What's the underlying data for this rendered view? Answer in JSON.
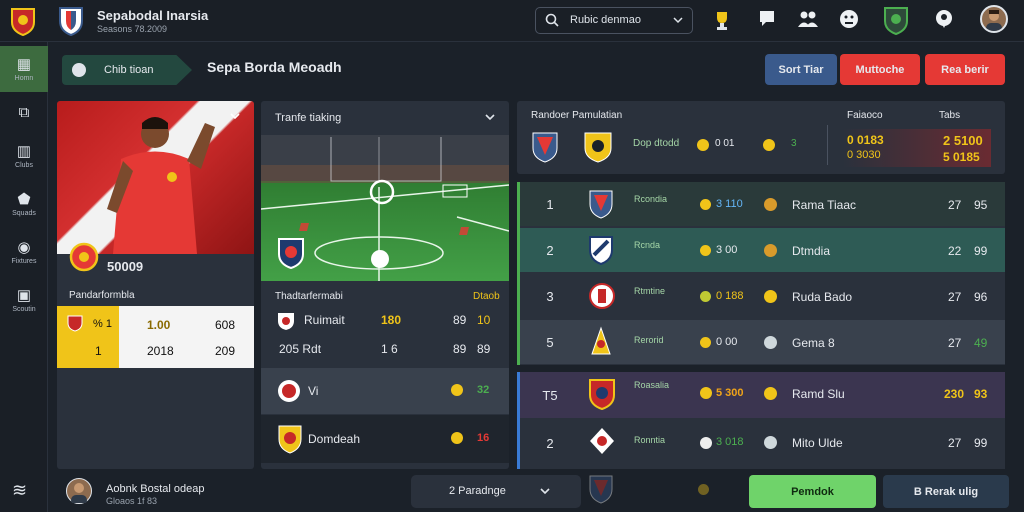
{
  "app": {
    "title": "Sepabodal Inarsia",
    "subtitle": "Seasons 78.2009"
  },
  "search": {
    "value": "Rubic denmao"
  },
  "nav": {
    "active_label": "Chib tioan"
  },
  "page_title": "Sepa Borda Meoadh",
  "sidebar": {
    "items": [
      {
        "label": "Homn",
        "icon": "dashboard-icon"
      },
      {
        "label": "",
        "icon": "inbox-icon"
      },
      {
        "label": "Clubs",
        "icon": "building-icon"
      },
      {
        "label": "Squads",
        "icon": "shield-icon"
      },
      {
        "label": "Fixtures",
        "icon": "ball-icon"
      },
      {
        "label": "Scoutin",
        "icon": "bag-icon"
      }
    ]
  },
  "header_buttons": [
    {
      "label": "Sort Tiar",
      "color": "#3a5a8c"
    },
    {
      "label": "Muttoche",
      "color": "#e53935"
    },
    {
      "label": "Rea berir",
      "color": "#e53935"
    }
  ],
  "player": {
    "score": "50009",
    "section": "Pandarformbla",
    "stats": [
      {
        "a": "% 1",
        "b": "1.00",
        "c": "608"
      },
      {
        "a": "1",
        "b": "2018",
        "c": "209"
      }
    ]
  },
  "transfer": {
    "title": "Tranfe tiaking",
    "section": "Thadtarfermabi",
    "section_right": "Dtaob",
    "rows": [
      {
        "name": "Ruimait",
        "v1": "180",
        "v2": "89",
        "v3": "10"
      },
      {
        "name": "205 Rdt",
        "v1": "1 6",
        "v2": "89",
        "v3": "89"
      }
    ],
    "list": [
      {
        "name": "Vi",
        "val": "32"
      },
      {
        "name": "Domdeah",
        "val": "16"
      }
    ]
  },
  "match": {
    "label_left": "Randoer Pamulatian",
    "label_right": "Faiaoco",
    "label_right2": "Tabs",
    "mid_a": "Dop dtodd",
    "mid_b": "0 01",
    "mid_c": "3",
    "score_left": "0 0183",
    "score_left2": "0 3030",
    "score_right": "2 5100",
    "score_right2": "5 0185"
  },
  "standings": [
    {
      "rank": "1",
      "team": "Rcondia",
      "stat": "3 110",
      "name": "Rama Tiaac",
      "pts": "27",
      "gd": "95"
    },
    {
      "rank": "2",
      "team": "Rcnda",
      "stat": "3 00",
      "name": "Dtmdia",
      "pts": "22",
      "gd": "99"
    },
    {
      "rank": "3",
      "team": "Rtmtine",
      "stat": "0 188",
      "name": "Ruda Bado",
      "pts": "27",
      "gd": "96"
    },
    {
      "rank": "5",
      "team": "Rerorid",
      "stat": "0 00",
      "name": "Gema 8",
      "pts": "27",
      "gd": "49"
    },
    {
      "rank": "T5",
      "team": "Roasalia",
      "stat": "5 300",
      "name": "Ramd Slu",
      "pts": "230",
      "gd": "93"
    },
    {
      "rank": "2",
      "team": "Ronntia",
      "stat": "3 018",
      "name": "Mito Ulde",
      "pts": "27",
      "gd": "99"
    }
  ],
  "footer": {
    "user_name": "Aobnk Bostal odeap",
    "user_sub": "Gloaos 1f 83",
    "dropdown": "2  Paradnge",
    "btn_green": "Pemdok",
    "btn_dark": "B Rerak ulig"
  },
  "colors": {
    "accent_green": "#4caf50",
    "accent_red": "#e53935",
    "accent_blue": "#3a5a8c",
    "highlight_yellow": "#f0c419"
  }
}
